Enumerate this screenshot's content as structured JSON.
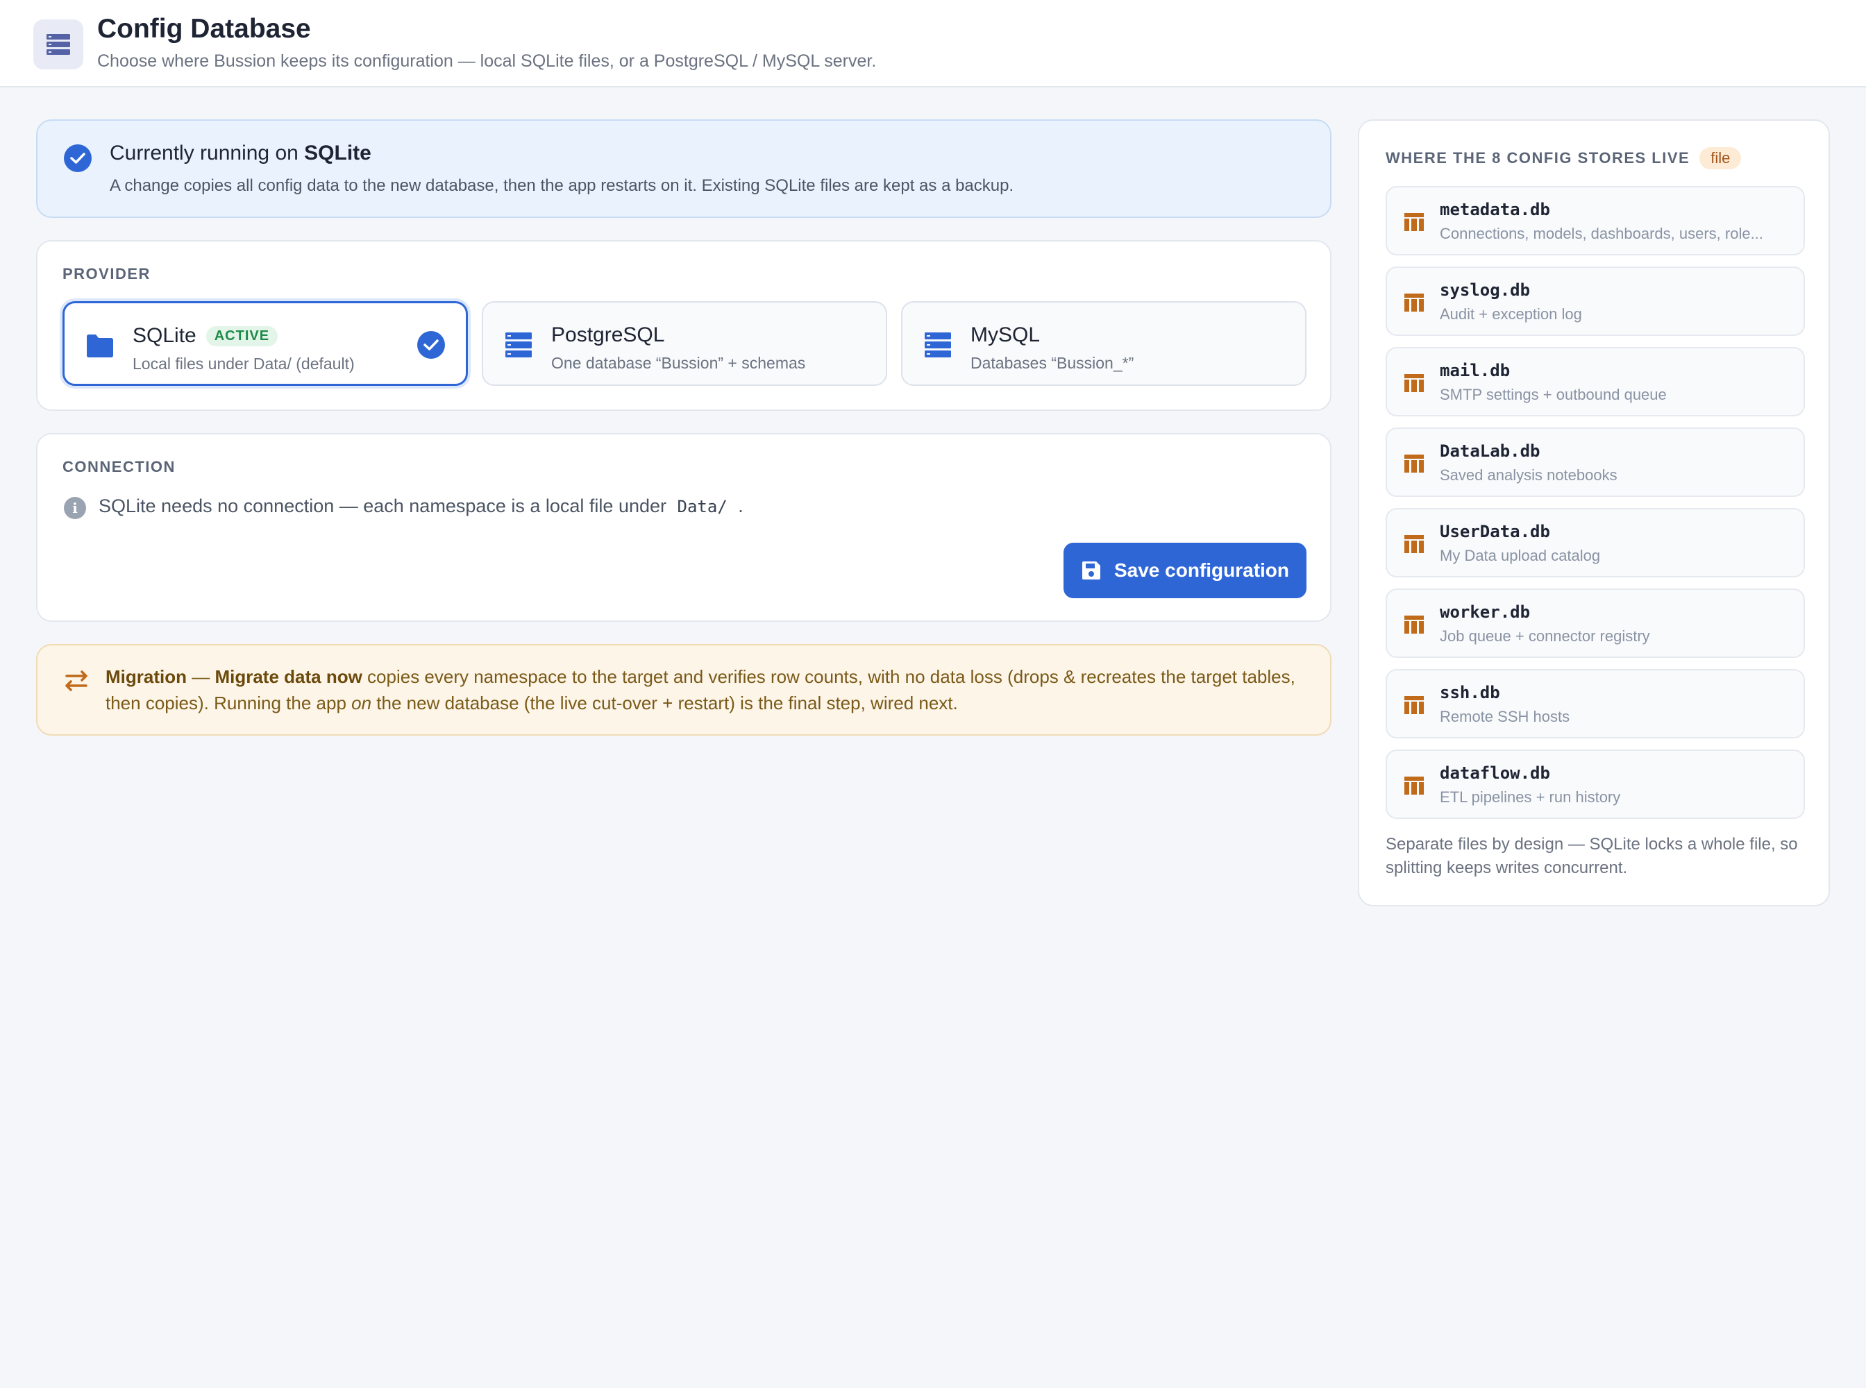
{
  "header": {
    "title": "Config Database",
    "subtitle": "Choose where Bussion keeps its configuration — local SQLite files, or a PostgreSQL / MySQL server."
  },
  "status": {
    "prefix": "Currently running on ",
    "provider": "SQLite",
    "message": "A change copies all config data to the new database, then the app restarts on it. Existing SQLite files are kept as a backup."
  },
  "provider": {
    "label": "PROVIDER",
    "options": [
      {
        "name": "SQLite",
        "badge": "ACTIVE",
        "desc": "Local files under Data/ (default)",
        "icon": "folder-icon"
      },
      {
        "name": "PostgreSQL",
        "desc": "One database “Bussion” + schemas",
        "icon": "server-icon"
      },
      {
        "name": "MySQL",
        "desc": "Databases “Bussion_*”",
        "icon": "server-icon"
      }
    ]
  },
  "connection": {
    "label": "CONNECTION",
    "text_before": "SQLite needs no connection — each namespace is a local file under",
    "path": "Data/",
    "text_after": ".",
    "save_label": "Save configuration"
  },
  "migration": {
    "title": "Migration",
    "dash": " — ",
    "action": "Migrate data now",
    "text1": " copies every namespace to the target and verifies row counts, with no data loss (drops & recreates the target tables, then copies). Running the app ",
    "emph": "on",
    "text2": " the new database (the live cut-over + restart) is the final step, wired next."
  },
  "stores": {
    "title": "WHERE THE 8 CONFIG STORES LIVE",
    "badge": "file",
    "items": [
      {
        "name": "metadata.db",
        "desc": "Connections, models, dashboards, users, role..."
      },
      {
        "name": "syslog.db",
        "desc": "Audit + exception log"
      },
      {
        "name": "mail.db",
        "desc": "SMTP settings + outbound queue"
      },
      {
        "name": "DataLab.db",
        "desc": "Saved analysis notebooks"
      },
      {
        "name": "UserData.db",
        "desc": "My Data upload catalog"
      },
      {
        "name": "worker.db",
        "desc": "Job queue + connector registry"
      },
      {
        "name": "ssh.db",
        "desc": "Remote SSH hosts"
      },
      {
        "name": "dataflow.db",
        "desc": "ETL pipelines + run history"
      }
    ],
    "footer": "Separate files by design — SQLite locks a whole file, so splitting keeps writes concurrent."
  },
  "colors": {
    "accent": "#2f66d6",
    "active_badge": "#1f8a47",
    "store_icon": "#c06a1a",
    "migration_text": "#7a5a18"
  }
}
